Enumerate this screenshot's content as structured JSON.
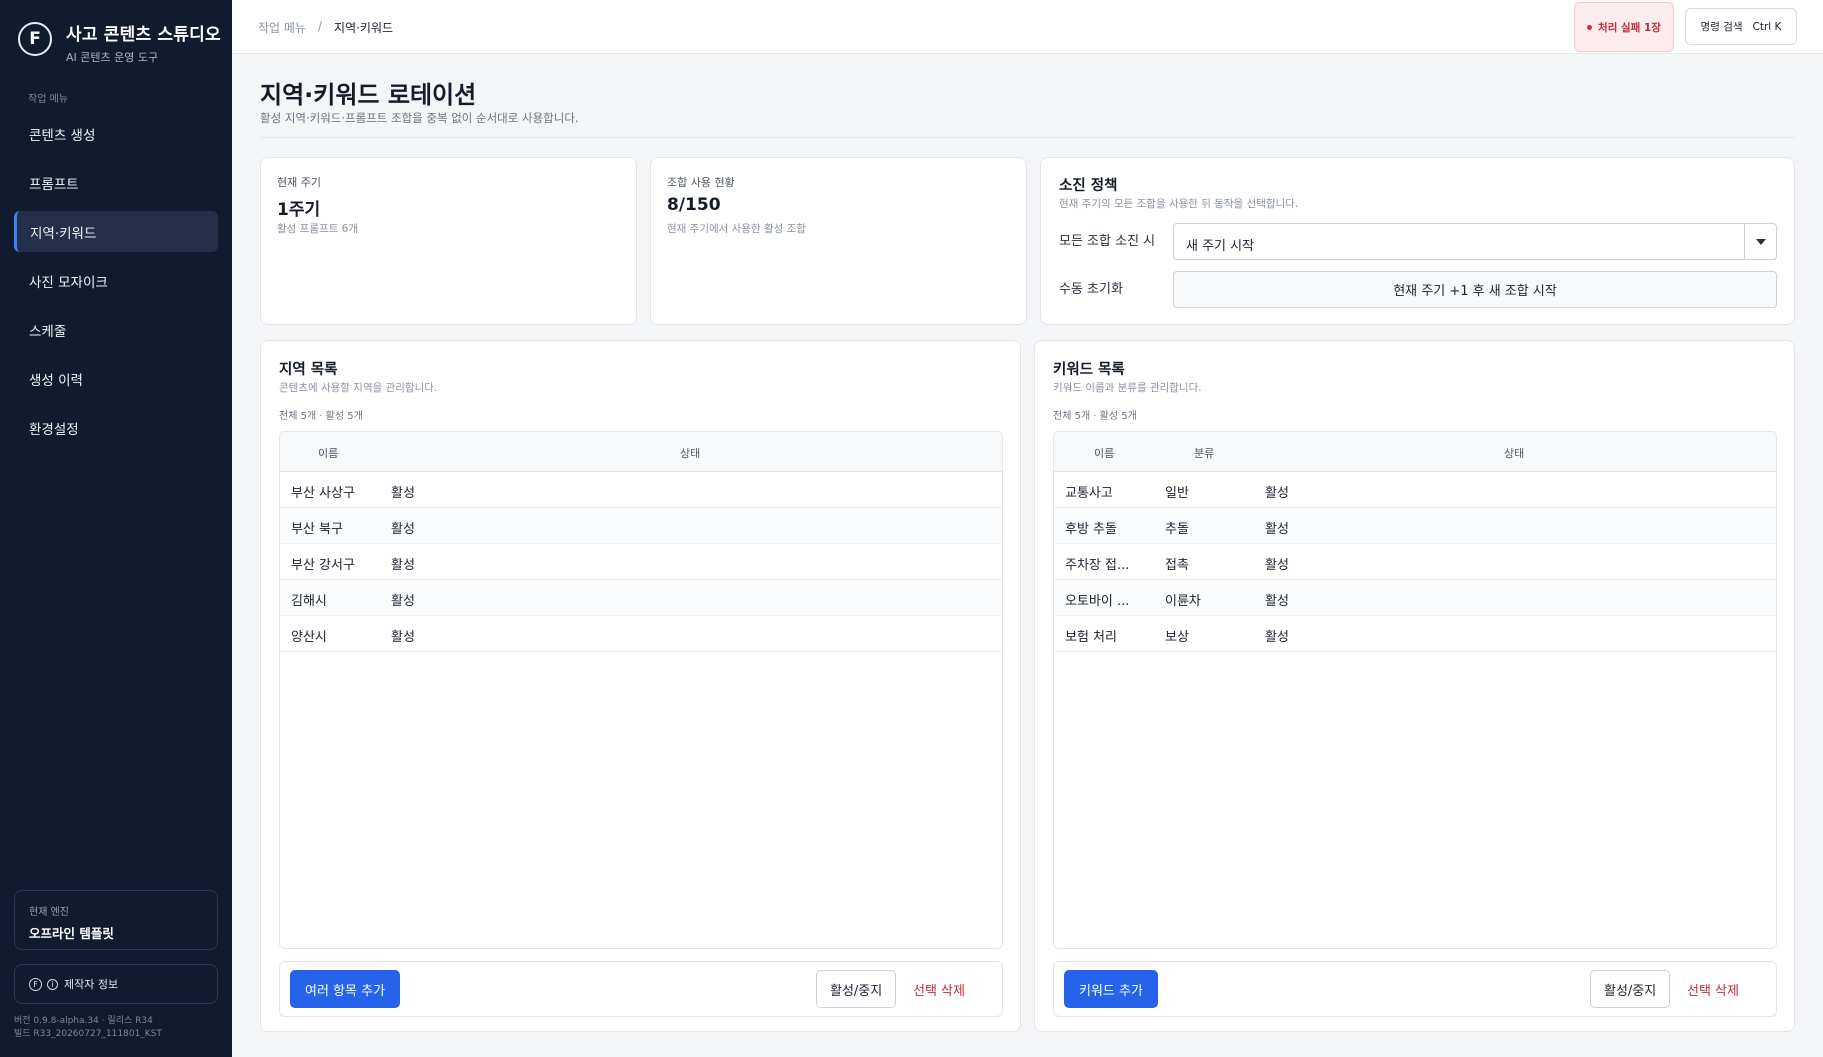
{
  "brand": {
    "logo_letter": "F",
    "title": "사고 콘텐츠 스튜디오",
    "subtitle": "AI 콘텐츠 운영 도구"
  },
  "sidebar": {
    "section_label": "작업 메뉴",
    "items": [
      {
        "label": "콘텐츠 생성",
        "active": false
      },
      {
        "label": "프롬프트",
        "active": false
      },
      {
        "label": "지역·키워드",
        "active": true
      },
      {
        "label": "사진 모자이크",
        "active": false
      },
      {
        "label": "스케줄",
        "active": false
      },
      {
        "label": "생성 이력",
        "active": false
      },
      {
        "label": "환경설정",
        "active": false
      }
    ],
    "engine_label": "현재 엔진",
    "engine_value": "오프라인 템플릿",
    "maker_label": "제작자 정보",
    "version_line1": "버전 0.9.8-alpha.34 · 릴리스 R34",
    "version_line2": "빌드 R33_20260727_111801_KST"
  },
  "topbar": {
    "breadcrumb_root": "작업 메뉴",
    "breadcrumb_sep": "/",
    "breadcrumb_current": "지역·키워드",
    "fail_badge": "처리 실패 1장",
    "command_search": "명령 검색",
    "command_shortcut": "Ctrl K"
  },
  "page": {
    "title": "지역·키워드 로테이션",
    "description": "활성 지역·키워드·프롬프트 조합을 중복 없이 순서대로 사용합니다."
  },
  "stats": {
    "cycle": {
      "label": "현재 주기",
      "value": "1주기",
      "sub": "활성 프롬프트 6개"
    },
    "usage": {
      "label": "조합 사용 현황",
      "value": "8/150",
      "sub": "현재 주기에서 사용한 활성 조합"
    }
  },
  "policy": {
    "title": "소진 정책",
    "description": "현재 주기의 모든 조합을 사용한 뒤 동작을 선택합니다.",
    "exhaust_label": "모든 조합 소진 시",
    "exhaust_value": "새 주기 시작",
    "reset_label": "수동 초기화",
    "reset_button": "현재 주기 +1 후 새 조합 시작"
  },
  "regions": {
    "title": "지역 목록",
    "description": "콘텐츠에 사용할 지역을 관리합니다.",
    "count": "전체 5개 · 활성 5개",
    "columns": [
      "이름",
      "상태"
    ],
    "rows": [
      {
        "name": "부산 사상구",
        "status": "활성"
      },
      {
        "name": "부산 북구",
        "status": "활성"
      },
      {
        "name": "부산 강서구",
        "status": "활성"
      },
      {
        "name": "김해시",
        "status": "활성"
      },
      {
        "name": "양산시",
        "status": "활성"
      }
    ],
    "add_button": "여러 항목 추가",
    "toggle_button": "활성/중지",
    "delete_button": "선택 삭제"
  },
  "keywords": {
    "title": "키워드 목록",
    "description": "키워드 이름과 분류를 관리합니다.",
    "count": "전체 5개 · 활성 5개",
    "columns": [
      "이름",
      "분류",
      "상태"
    ],
    "rows": [
      {
        "name": "교통사고",
        "category": "일반",
        "status": "활성"
      },
      {
        "name": "후방 추돌",
        "category": "추돌",
        "status": "활성"
      },
      {
        "name": "주차장 접...",
        "category": "접촉",
        "status": "활성"
      },
      {
        "name": "오토바이 ...",
        "category": "이륜차",
        "status": "활성"
      },
      {
        "name": "보험 처리",
        "category": "보상",
        "status": "활성"
      }
    ],
    "add_button": "키워드 추가",
    "toggle_button": "활성/중지",
    "delete_button": "선택 삭제"
  },
  "colors": {
    "sidebar_bg": "#111a2e",
    "primary": "#2563eb",
    "danger": "#c42b3a"
  }
}
